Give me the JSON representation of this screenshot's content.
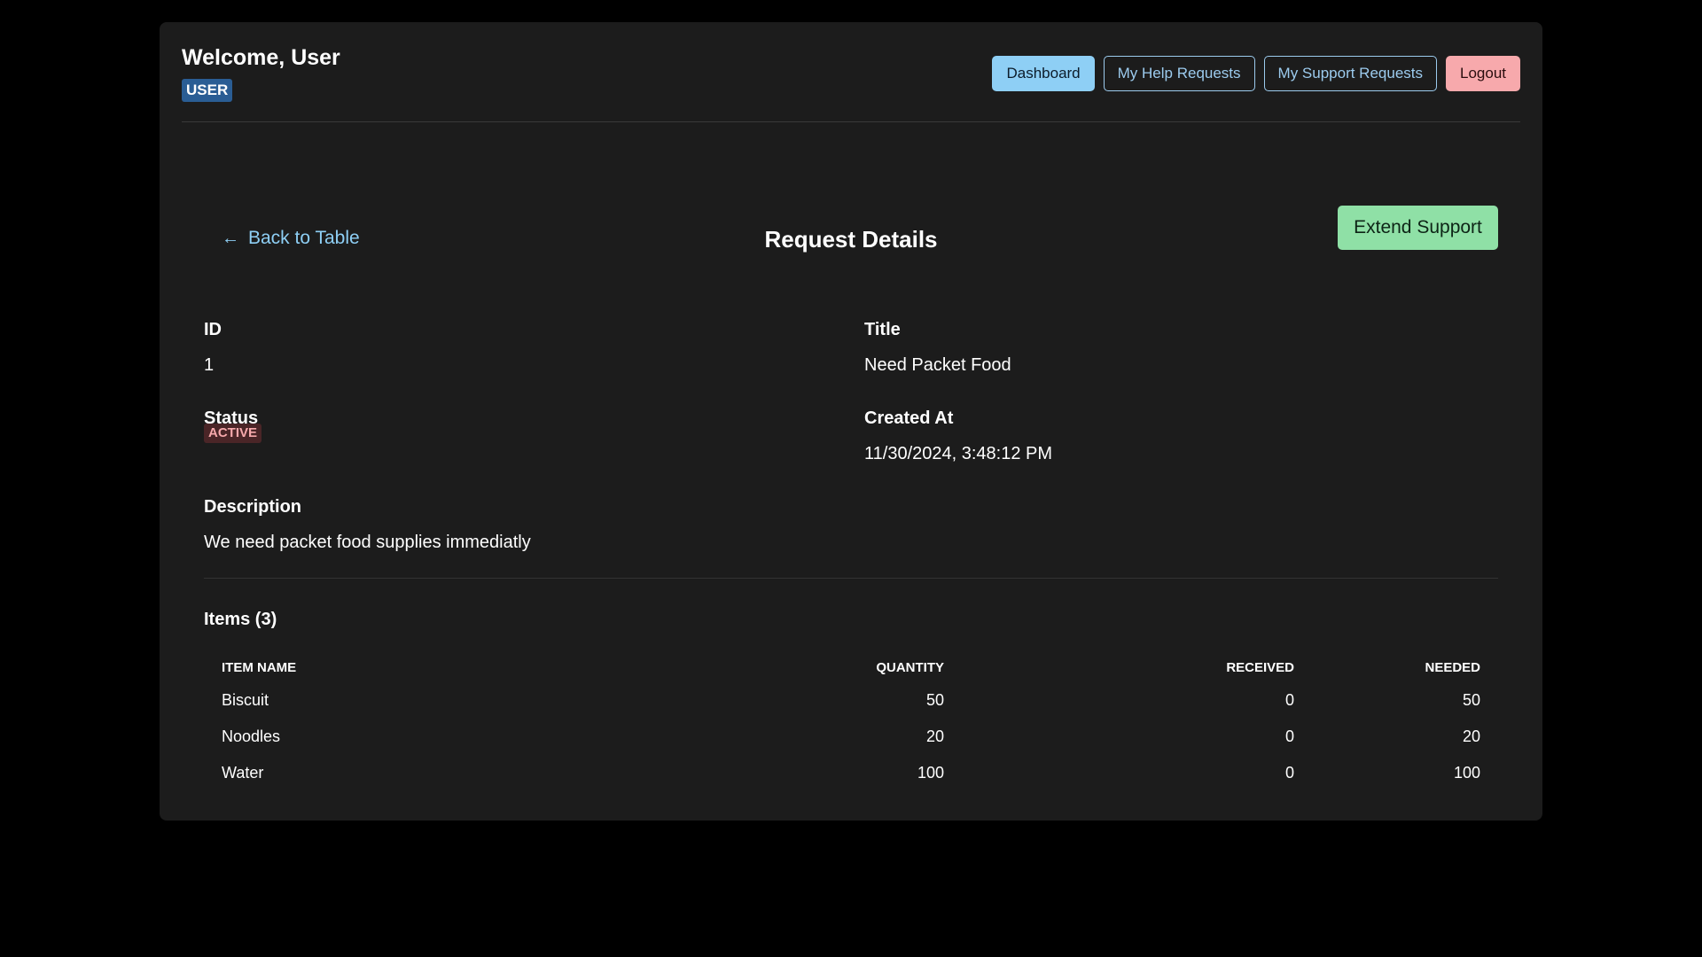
{
  "header": {
    "welcome": "Welcome, User",
    "role_badge": "USER",
    "nav": {
      "dashboard": "Dashboard",
      "help_requests": "My Help Requests",
      "support_requests": "My Support Requests",
      "logout": "Logout"
    }
  },
  "toolbar": {
    "back_label": "Back to Table",
    "back_icon": "arrow-left-icon",
    "title": "Request Details",
    "extend_label": "Extend Support"
  },
  "details": {
    "id_label": "ID",
    "id_value": "1",
    "title_label": "Title",
    "title_value": "Need Packet Food",
    "status_label": "Status",
    "status_value": "ACTIVE",
    "created_label": "Created At",
    "created_value": "11/30/2024, 3:48:12 PM",
    "description_label": "Description",
    "description_value": "We need packet food supplies immediatly"
  },
  "items": {
    "heading": "Items (3)",
    "columns": [
      "ITEM NAME",
      "QUANTITY",
      "RECEIVED",
      "NEEDED"
    ],
    "rows": [
      [
        "Biscuit",
        "50",
        "0",
        "50"
      ],
      [
        "Noodles",
        "20",
        "0",
        "20"
      ],
      [
        "Water",
        "100",
        "0",
        "100"
      ]
    ]
  },
  "colors": {
    "background": "#000000",
    "card": "#1c1c1c",
    "primary": "#8ecff5",
    "success": "#8fe0a6",
    "danger": "#f7a9ac",
    "role_badge": "#2a5d94"
  }
}
